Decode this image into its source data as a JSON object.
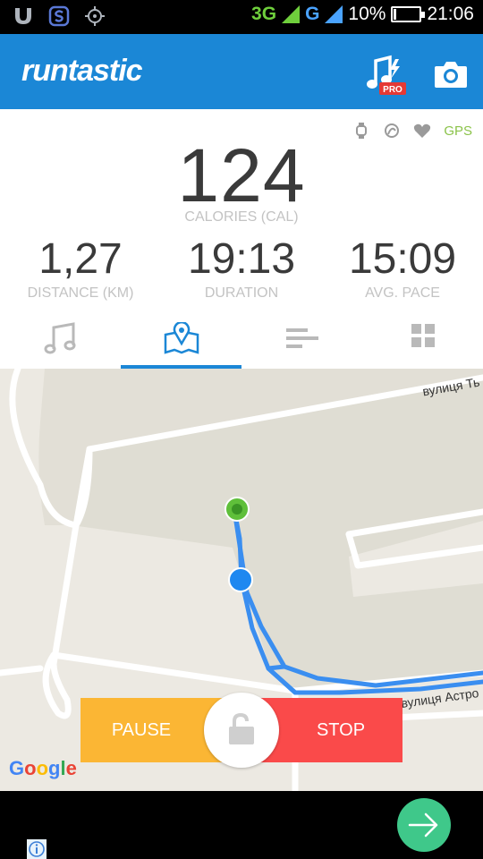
{
  "status_bar": {
    "network1": "3G",
    "network2": "G",
    "battery_text": "10%",
    "battery_level": 0.1,
    "time": "21:06"
  },
  "app_bar": {
    "logo": "runtastic",
    "pro_badge": "PRO"
  },
  "stats": {
    "sensors": [
      "watch-icon",
      "cadence-icon",
      "heart-icon"
    ],
    "gps_label": "GPS",
    "calories": {
      "value": "124",
      "label": "CALORIES (CAL)"
    },
    "distance": {
      "value": "1,27",
      "label": "DISTANCE (KM)"
    },
    "duration": {
      "value": "19:13",
      "label": "DURATION"
    },
    "pace": {
      "value": "15:09",
      "label": "AVG. PACE"
    }
  },
  "tabs": [
    {
      "name": "music",
      "icon": "music-note-icon",
      "selected": false
    },
    {
      "name": "map",
      "icon": "map-pin-icon",
      "selected": true
    },
    {
      "name": "splits",
      "icon": "bars-icon",
      "selected": false
    },
    {
      "name": "dashboard",
      "icon": "grid-icon",
      "selected": false
    }
  ],
  "map": {
    "street_top": "вулиця Ть",
    "street_bottom": "вулиця Астро",
    "attribution": [
      "G",
      "o",
      "o",
      "g",
      "l",
      "e"
    ],
    "route_color": "#3a8ef0",
    "start_marker_color": "#5fbf3a",
    "current_marker_color": "#1e88f0"
  },
  "controls": {
    "pause_label": "PAUSE",
    "stop_label": "STOP",
    "pause_color": "#fbb634",
    "stop_color": "#fa4a4a"
  },
  "colors": {
    "brand_blue": "#1b87d6",
    "next_green": "#3fc88a"
  }
}
